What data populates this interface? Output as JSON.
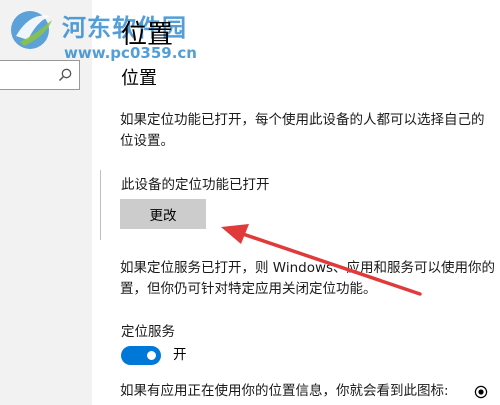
{
  "watermark": {
    "site_name": "河东软件园",
    "site_url": "www.pc0359.cn"
  },
  "sidebar": {
    "search_placeholder": ""
  },
  "page": {
    "title": "位置",
    "section_heading": "位置",
    "intro_text": "如果定位功能已打开，每个使用此设备的人都可以选择自己的",
    "intro_text_cont": "位设置。",
    "device_status": "此设备的定位功能已打开",
    "change_button_label": "更改",
    "service_info_line1": "如果定位服务已打开，则 Windows、应用和服务可以使用你的",
    "service_info_line2": "置，但你仍可针对特定应用关闭定位功能。",
    "service_label": "定位服务",
    "service_toggle_state": "开",
    "service_toggle_on": true,
    "icon_info_text": "如果有应用正在使用你的位置信息，你就会看到此图标:"
  },
  "colors": {
    "accent": "#0078d7",
    "button_bg": "#cccccc",
    "arrow": "#e03a3a",
    "watermark": "#2a86cf"
  }
}
